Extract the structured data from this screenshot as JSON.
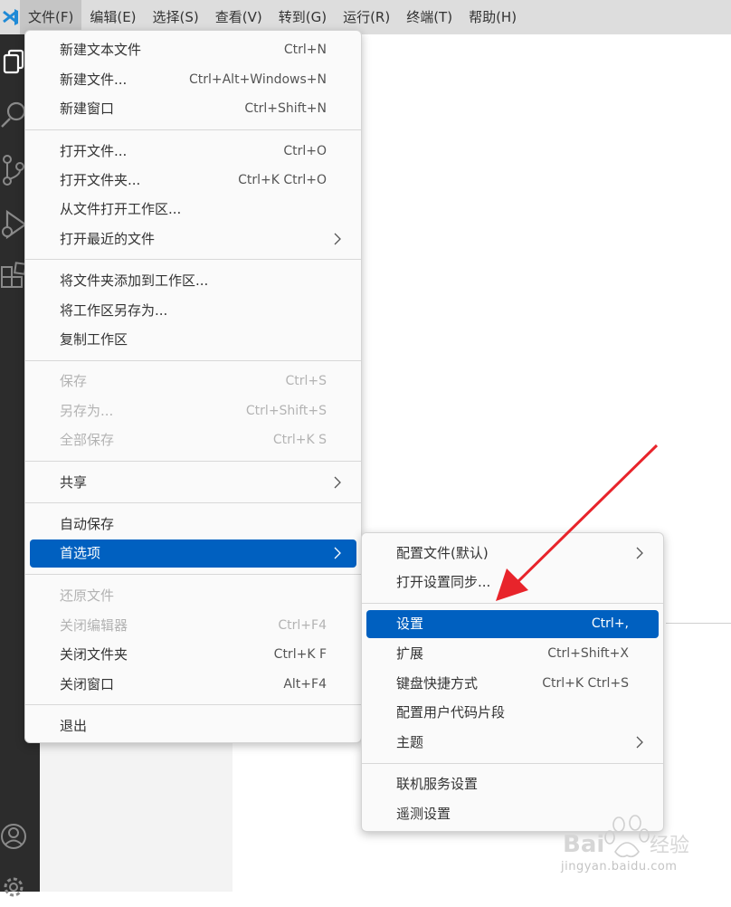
{
  "menubar": {
    "items": [
      "文件(F)",
      "编辑(E)",
      "选择(S)",
      "查看(V)",
      "转到(G)",
      "运行(R)",
      "终端(T)",
      "帮助(H)"
    ],
    "active_index": 0
  },
  "activity_bar": {
    "icons": [
      "explorer-icon",
      "search-icon",
      "source-control-icon",
      "run-debug-icon",
      "extensions-icon",
      "account-icon",
      "manage-gear-icon"
    ]
  },
  "file_menu": {
    "items": [
      {
        "label": "新建文本文件",
        "key": "Ctrl+N"
      },
      {
        "label": "新建文件...",
        "key": "Ctrl+Alt+Windows+N"
      },
      {
        "label": "新建窗口",
        "key": "Ctrl+Shift+N"
      },
      {
        "label": "打开文件...",
        "key": "Ctrl+O"
      },
      {
        "label": "打开文件夹...",
        "key": "Ctrl+K Ctrl+O"
      },
      {
        "label": "从文件打开工作区...",
        "key": ""
      },
      {
        "label": "打开最近的文件",
        "key": ""
      },
      {
        "label": "将文件夹添加到工作区...",
        "key": ""
      },
      {
        "label": "将工作区另存为...",
        "key": ""
      },
      {
        "label": "复制工作区",
        "key": ""
      },
      {
        "label": "保存",
        "key": "Ctrl+S"
      },
      {
        "label": "另存为...",
        "key": "Ctrl+Shift+S"
      },
      {
        "label": "全部保存",
        "key": "Ctrl+K S"
      },
      {
        "label": "共享",
        "key": ""
      },
      {
        "label": "自动保存",
        "key": ""
      },
      {
        "label": "首选项",
        "key": ""
      },
      {
        "label": "还原文件",
        "key": ""
      },
      {
        "label": "关闭编辑器",
        "key": "Ctrl+F4"
      },
      {
        "label": "关闭文件夹",
        "key": "Ctrl+K F"
      },
      {
        "label": "关闭窗口",
        "key": "Alt+F4"
      },
      {
        "label": "退出",
        "key": ""
      }
    ]
  },
  "preferences_submenu": {
    "items": [
      {
        "label": "配置文件(默认)",
        "key": ""
      },
      {
        "label": "打开设置同步...",
        "key": ""
      },
      {
        "label": "设置",
        "key": "Ctrl+,"
      },
      {
        "label": "扩展",
        "key": "Ctrl+Shift+X"
      },
      {
        "label": "键盘快捷方式",
        "key": "Ctrl+K Ctrl+S"
      },
      {
        "label": "配置用户代码片段",
        "key": ""
      },
      {
        "label": "主题",
        "key": ""
      },
      {
        "label": "联机服务设置",
        "key": ""
      },
      {
        "label": "遥测设置",
        "key": ""
      }
    ]
  },
  "watermark": {
    "brand": "Baidu 经验",
    "url": "jingyan.baidu.com"
  },
  "colors": {
    "menubar_bg": "#dddddd",
    "activity_bar_bg": "#2c2c2c",
    "sidebar_bg": "#f3f3f3",
    "highlight": "#0060c0",
    "arrow": "#e8242b"
  }
}
